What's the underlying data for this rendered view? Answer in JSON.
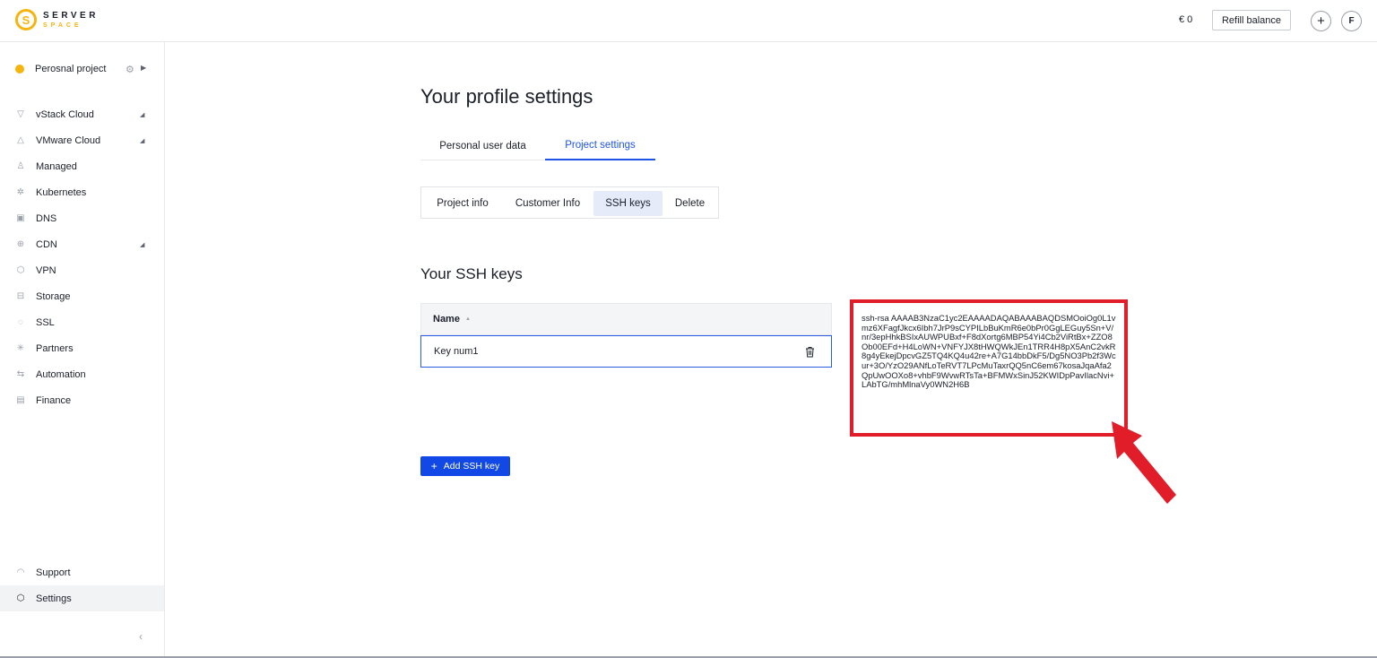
{
  "header": {
    "logo_top": "SERVER",
    "logo_bottom": "SPACE",
    "logo_mark": "S",
    "balance": "€ 0",
    "refill_label": "Refill balance",
    "add_label": "+",
    "user_initial": "F"
  },
  "sidebar": {
    "project_name": "Perosnal project",
    "project_dot_color": "#f5b50e",
    "items": [
      {
        "label": "vStack Cloud",
        "icon": "triangle-down-icon",
        "glyph": "▽",
        "has_caret": true
      },
      {
        "label": "VMware Cloud",
        "icon": "cloud-icon",
        "glyph": "△",
        "has_caret": true
      },
      {
        "label": "Managed",
        "icon": "person-icon",
        "glyph": "♙",
        "has_caret": false
      },
      {
        "label": "Kubernetes",
        "icon": "helm-icon",
        "glyph": "✲",
        "has_caret": false
      },
      {
        "label": "DNS",
        "icon": "dns-icon",
        "glyph": "▣",
        "has_caret": false
      },
      {
        "label": "CDN",
        "icon": "globe-icon",
        "glyph": "⊕",
        "has_caret": true
      },
      {
        "label": "VPN",
        "icon": "shield-icon",
        "glyph": "⬡",
        "has_caret": false
      },
      {
        "label": "Storage",
        "icon": "database-icon",
        "glyph": "⊟",
        "has_caret": false
      },
      {
        "label": "SSL",
        "icon": "lock-shield-icon",
        "glyph": "◌",
        "has_caret": false
      },
      {
        "label": "Partners",
        "icon": "asterisk-icon",
        "glyph": "✳",
        "has_caret": false
      },
      {
        "label": "Automation",
        "icon": "arrows-icon",
        "glyph": "⇆",
        "has_caret": false
      },
      {
        "label": "Finance",
        "icon": "document-icon",
        "glyph": "▤",
        "has_caret": false
      }
    ],
    "support_label": "Support",
    "settings_label": "Settings",
    "collapse_glyph": "‹"
  },
  "main": {
    "title": "Your profile settings",
    "tabs": [
      "Personal user data",
      "Project settings"
    ],
    "active_tab": "Project settings",
    "subtabs": [
      "Project info",
      "Customer Info",
      "SSH keys",
      "Delete"
    ],
    "active_subtab": "SSH keys",
    "section_title": "Your SSH keys",
    "table": {
      "column_name": "Name",
      "rows": [
        {
          "name": "Key num1"
        }
      ]
    },
    "ssh_key": "ssh-rsa AAAAB3NzaC1yc2EAAAADAQABAAABAQDSMOoiOg0L1vmz6XFagfJkcx6Ibh7JrP9sCYPILbBuKmR6e0bPr0GgLEGuy5Sn+V/nr/3epHhkBSIxAUWPUBxf+F8dXortg6MBP54Yi4Cb2ViRtBx+ZZO8Ob00EFd+H4LoWN+VNFYJX8tHWQWkJEn1TRR4H8pX5AnC2vkR8g4yEkejDpcvGZ5TQ4KQ4u42re+A7G14bbDkF5/Dg5NO3Pb2f3Wcur+3O/YzO29ANfLoTeRVT7LPcMuTaxrQQ5nC6em67kosaJqaAfa2QpUwOOXo8+vhbF9WvwRTsTa+BFMWxSinJ52KWIDpPavIlacNvi+LAbTG/mhMlnaVy0WN2H6B",
    "add_button_label": "Add SSH key",
    "accent_color": "#1e55e6",
    "highlight_color": "#e11d2a"
  }
}
